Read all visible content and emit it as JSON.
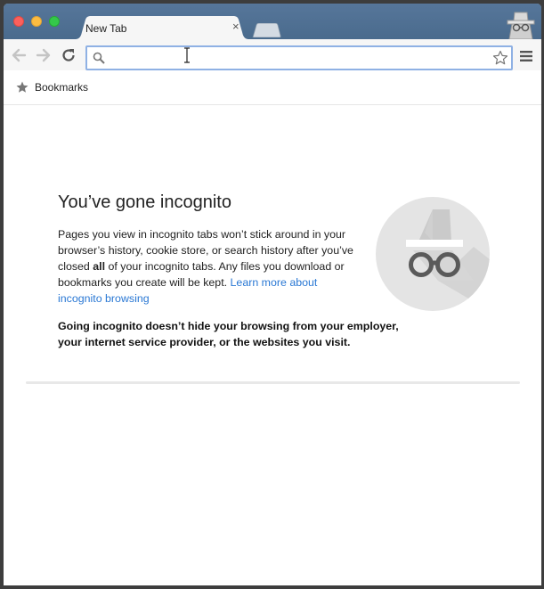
{
  "window": {
    "tab": {
      "title": "New Tab",
      "close_glyph": "×"
    }
  },
  "toolbar": {
    "omnibox": {
      "value": "",
      "placeholder": ""
    }
  },
  "bookmarks_bar": {
    "label": "Bookmarks"
  },
  "incognito_page": {
    "heading": "You’ve gone incognito",
    "paragraph": {
      "text_1": "Pages you view in incognito tabs won’t stick around in your browser’s history, cookie store, or search history after you’ve closed ",
      "bold": "all",
      "text_2": " of your incognito tabs. Any files you download or bookmarks you create will be kept. ",
      "link": "Learn more about incognito browsing"
    },
    "warning": "Going incognito doesn’t hide your browsing from your employer, your internet service provider, or the websites you visit."
  },
  "colors": {
    "titlebar": "#52708f",
    "link": "#2a78d4",
    "omnibox_focus": "#8fb1e4"
  }
}
